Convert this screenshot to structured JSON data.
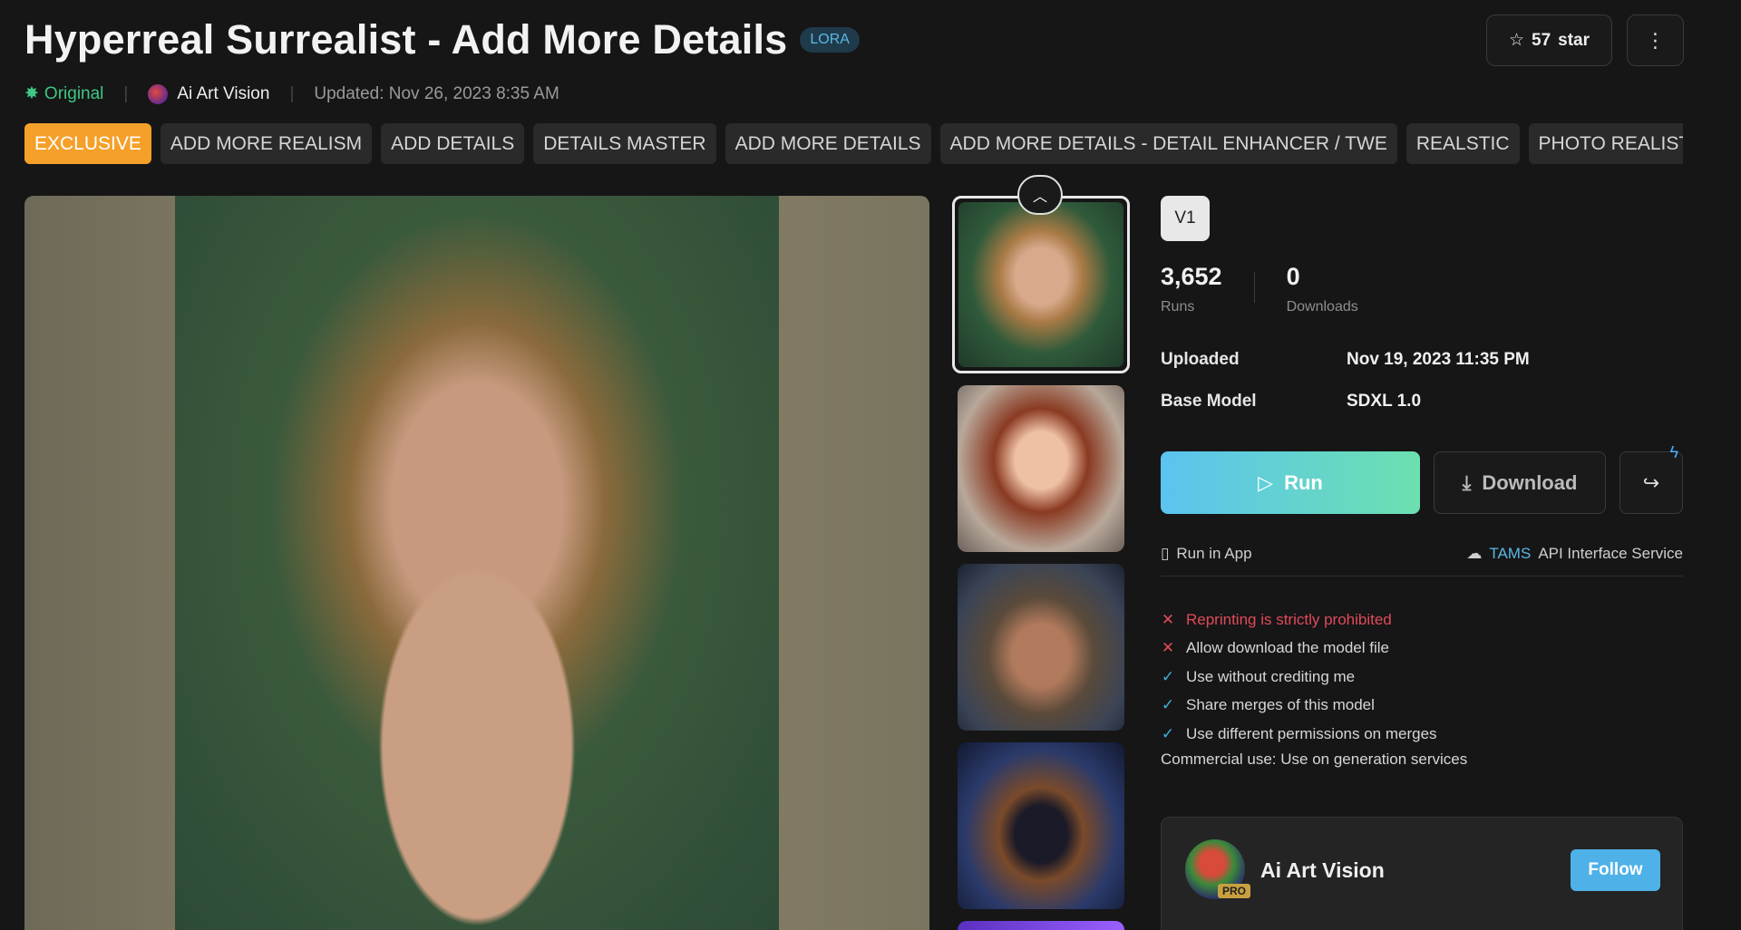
{
  "header": {
    "title": "Hyperreal Surrealist - Add More Details",
    "type_badge": "LORA",
    "star_count": "57",
    "star_label": "star",
    "more_icon": "more-vertical-icon"
  },
  "meta": {
    "original": "Original",
    "author": "Ai Art Vision",
    "updated": "Updated: Nov 26, 2023 8:35 AM"
  },
  "tags": [
    "EXCLUSIVE",
    "ADD MORE REALISM",
    "ADD DETAILS",
    "DETAILS MASTER",
    "ADD MORE DETAILS",
    "ADD MORE DETAILS - DETAIL ENHANCER / TWE",
    "REALSTIC",
    "PHOTO REALISTIC"
  ],
  "version": "V1",
  "stats": {
    "runs": "3,652",
    "runs_label": "Runs",
    "downloads": "0",
    "downloads_label": "Downloads"
  },
  "info": {
    "uploaded_label": "Uploaded",
    "uploaded_value": "Nov 19, 2023 11:35 PM",
    "base_model_label": "Base Model",
    "base_model_value": "SDXL 1.0"
  },
  "actions": {
    "run": "Run",
    "download": "Download"
  },
  "links": {
    "run_in_app": "Run in App",
    "tams": "TAMS",
    "api": "API Interface Service"
  },
  "permissions": [
    {
      "allowed": false,
      "text": "Reprinting is strictly prohibited",
      "highlight": true
    },
    {
      "allowed": false,
      "text": "Allow download the model file",
      "highlight": false
    },
    {
      "allowed": true,
      "text": "Use without crediting me",
      "highlight": false
    },
    {
      "allowed": true,
      "text": "Share merges of this model",
      "highlight": false
    },
    {
      "allowed": true,
      "text": "Use different permissions on merges",
      "highlight": false
    }
  ],
  "commercial": "Commercial use: Use on generation services",
  "author_card": {
    "name": "Ai Art Vision",
    "badge": "PRO",
    "follow": "Follow"
  },
  "colors": {
    "accent": "#4eb2e8",
    "exclusive": "#f5a02a",
    "original": "#3fc684",
    "prohibited": "#e04a5a"
  }
}
